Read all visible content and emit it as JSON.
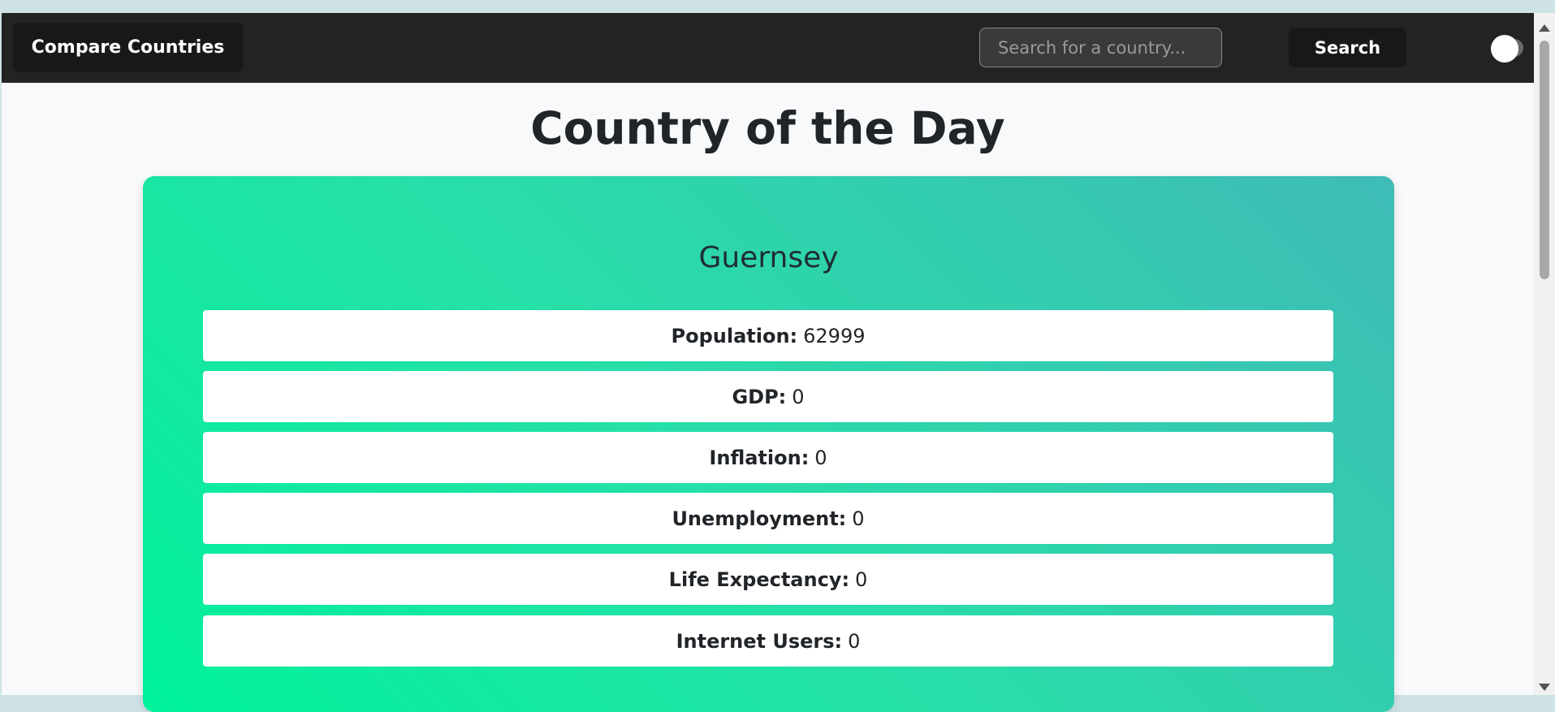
{
  "navbar": {
    "brand_label": "Compare Countries",
    "search_placeholder": "Search for a country...",
    "search_button_label": "Search",
    "theme_toggle_icon": "toggle-switch-icon"
  },
  "main": {
    "title": "Country of the Day",
    "country": {
      "name": "Guernsey",
      "stats": [
        {
          "label": "Population:",
          "value": "62999"
        },
        {
          "label": "GDP:",
          "value": "0"
        },
        {
          "label": "Inflation:",
          "value": "0"
        },
        {
          "label": "Unemployment:",
          "value": "0"
        },
        {
          "label": "Life Expectancy:",
          "value": "0"
        },
        {
          "label": "Internet Users:",
          "value": "0"
        }
      ]
    }
  },
  "colors": {
    "navbar_bg": "#232323",
    "card_gradient_start": "#00f29a",
    "card_gradient_end": "#3fbbb6",
    "page_bg": "#f8f9fa"
  }
}
